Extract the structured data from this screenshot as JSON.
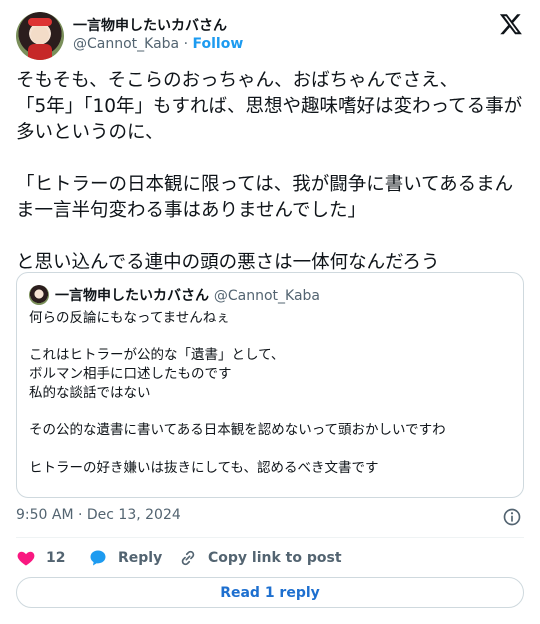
{
  "author": {
    "display_name": "一言物申したいカバさん",
    "handle": "@Cannot_Kaba",
    "separator": "·",
    "follow_label": "Follow"
  },
  "tweet": {
    "text": "そもそも、そこらのおっちゃん、おばちゃんでさえ、\n「5年」「10年」もすれば、思想や趣味嗜好は変わってる事が多いというのに、\n\n「ヒトラーの日本観に限っては、我が闘争に書いてあるまんま一言半句変わる事はありませんでした」\n\nと思い込んでる連中の頭の悪さは一体何なんだろう"
  },
  "quote": {
    "display_name": "一言物申したいカバさん",
    "handle": "@Cannot_Kaba",
    "text": "何らの反論にもなってませんねぇ\n\nこれはヒトラーが公的な「遺書」として、\nボルマン相手に口述したものです\n私的な談話ではない\n\nその公的な遺書に書いてある日本観を認めないって頭おかしいですわ\n\nヒトラーの好き嫌いは抜きにしても、認めるべき文書です"
  },
  "meta": {
    "timestamp": "9:50 AM · Dec 13, 2024"
  },
  "actions": {
    "like_count": "12",
    "reply_label": "Reply",
    "copy_label": "Copy link to post",
    "read_reply_label": "Read 1 reply"
  },
  "colors": {
    "accent": "#1d9bf0",
    "like": "#f91880",
    "text": "#0f1419",
    "muted": "#536471",
    "border": "#cfd9de"
  },
  "icons": [
    "x-logo-icon",
    "info-icon",
    "heart-icon",
    "reply-bubble-icon",
    "link-icon"
  ]
}
